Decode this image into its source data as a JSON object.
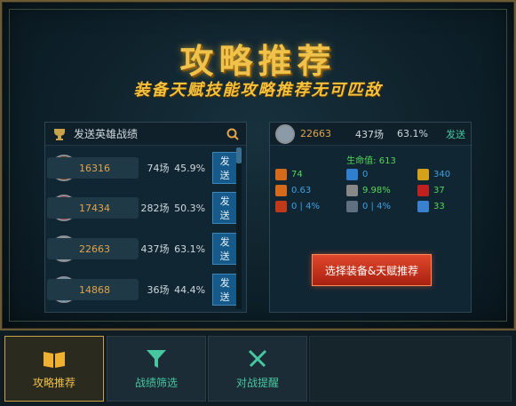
{
  "header": {
    "title": "攻略推荐",
    "subtitle": "装备天赋技能攻略推荐无可匹敌"
  },
  "left_panel": {
    "header_label": "发送英雄战绩",
    "heroes": [
      {
        "score": "16316",
        "games": "74场",
        "pct": "45.9%",
        "send": "发送",
        "avatar_color": "#6b3a1e"
      },
      {
        "score": "17434",
        "games": "282场",
        "pct": "50.3%",
        "send": "发送",
        "avatar_color": "#9a3140"
      },
      {
        "score": "22663",
        "games": "437场",
        "pct": "63.1%",
        "send": "发送",
        "avatar_color": "#8a9aa6"
      },
      {
        "score": "14868",
        "games": "36场",
        "pct": "44.4%",
        "send": "发送",
        "avatar_color": "#5f8fb0"
      }
    ]
  },
  "right_panel": {
    "score": "22663",
    "games": "437场",
    "pct": "63.1%",
    "send": "发送",
    "hp_label": "生命值: 613",
    "stats": [
      [
        {
          "value": "74",
          "color": "#55d655",
          "icon": "#d46a1a"
        },
        {
          "value": "0",
          "color": "#3fa0e0",
          "icon": "#2f7fd0"
        },
        {
          "value": "340",
          "color": "#3fa0e0",
          "icon": "#d4a21a"
        }
      ],
      [
        {
          "value": "0.63",
          "color": "#3fa0e0",
          "icon": "#d46a1a"
        },
        {
          "value": "9.98%",
          "color": "#55d655",
          "icon": "#888888"
        },
        {
          "value": "37",
          "color": "#55d655",
          "icon": "#c02020"
        }
      ],
      [
        {
          "value": "0 | 4%",
          "color": "#3fa0e0",
          "icon": "#c03a1a"
        },
        {
          "value": "0 | 4%",
          "color": "#3fa0e0",
          "icon": "#607080"
        },
        {
          "value": "33",
          "color": "#55d655",
          "icon": "#3a80d0"
        }
      ]
    ],
    "select_button": "选择装备&天赋推荐"
  },
  "nav": {
    "tabs": [
      {
        "label": "攻略推荐",
        "icon": "book-icon"
      },
      {
        "label": "战绩筛选",
        "icon": "filter-icon"
      },
      {
        "label": "对战提醒",
        "icon": "crossed-swords-icon"
      }
    ]
  },
  "colors": {
    "gold": "#f0c24a",
    "teal": "#47c7a0",
    "score_orange": "#e0a44a",
    "send_blue": "#155a8a"
  }
}
